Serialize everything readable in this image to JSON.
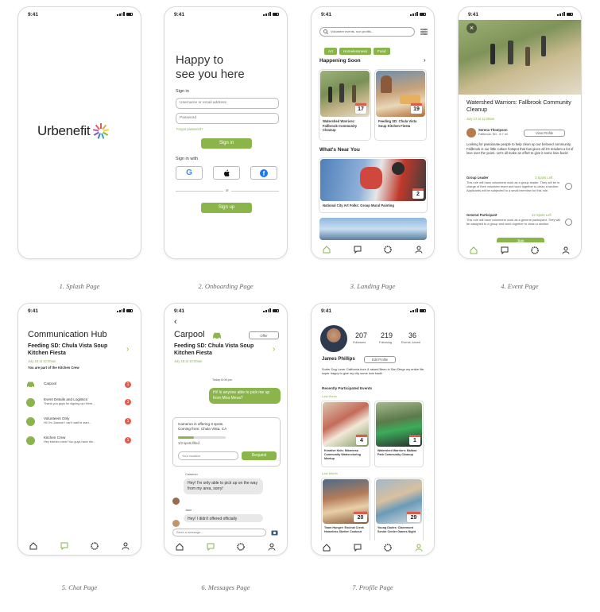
{
  "status": {
    "time": "9:41"
  },
  "captions": [
    "1. Splash Page",
    "2. Onboarding Page",
    "3. Landing Page",
    "4. Event Page",
    "5. Chat Page",
    "6. Messages Page",
    "7. Profile Page"
  ],
  "splash": {
    "logo_text": "Urbenefit"
  },
  "onboarding": {
    "headline_1": "Happy to",
    "headline_2": "see you here",
    "sign_in_label": "Sign in",
    "username_placeholder": "Username or email address",
    "password_placeholder": "Password",
    "forgot": "Forgot password?",
    "sign_in_button": "Sign in",
    "sign_in_with": "Sign in with",
    "or": "or",
    "sign_up_button": "Sign up"
  },
  "landing": {
    "search_placeholder": "Volunteer events, non profits...",
    "chips": [
      "Art",
      "Homelessness",
      "Food"
    ],
    "happening_soon": "Happening Soon",
    "events": [
      {
        "title": "Watershed Warriors: Fallbrook Community Cleanup",
        "day": "17"
      },
      {
        "title": "Feeding SD: Chula Vista Soup Kitchen Fiesta",
        "day": "19"
      }
    ],
    "whats_near": "What's Near You",
    "near_event": {
      "title": "National City Art Folks: Group Mural Painting",
      "day": "2"
    }
  },
  "event": {
    "title": "Watershed Warriors: Fallbrook Community Cleanup",
    "date": "July 17 at 11:00am",
    "host_name": "Serena Thompson",
    "host_loc": "Fallbrook, SD - 8.7 mi",
    "view_profile": "View Profile",
    "description": "Looking for passionate people to help clean up our beloved community. Fallbrook is our little culture hotspot that has given all it's resident a lot of love over the years. Let's all make an effort to give it some love back!",
    "roles": [
      {
        "name": "Group Leader",
        "spots": "3 Spots Left",
        "desc": "This role will have volunteers work as a group leader. They will be in charge of their volunteer team and work together to clean a section. Applicants will be subjected to a small interview for this role."
      },
      {
        "name": "General Participant",
        "spots": "22 Spots Left",
        "desc": "This role will have volunteers work as a general participant. They will be assigned to a group and work together to clean a section."
      }
    ],
    "join": "Join"
  },
  "chat": {
    "title": "Communication Hub",
    "event": "Feeding SD: Chula Vista Soup Kitchen Fiesta",
    "date": "July 18 at 10:00am",
    "crew_note": "You are part of the Kitchen Crew",
    "items": [
      {
        "name": "Carpool",
        "sub": "",
        "badge": "1"
      },
      {
        "name": "Event Details and Logistics",
        "sub": "Thank you guys for signing up! Here...",
        "badge": "3"
      },
      {
        "name": "Volunteers Only",
        "sub": "Hi! I'm Joanna! I can't wait to start...",
        "badge": "1"
      },
      {
        "name": "Kitchen Crew",
        "sub": "Hey kitchen crew! You guys have the...",
        "badge": "1"
      }
    ]
  },
  "messages": {
    "title": "Carpool",
    "offer": "Offer",
    "event": "Feeding SD: Chula Vista Soup Kitchen Fiesta",
    "date": "July 18 at 10:00am",
    "time_stamp": "Today 6:08 pm",
    "my_msg": "Hi! Is anyone able to pick me up from Mira Mesa?",
    "offer_line1": "Cameron is offering 3 spots.",
    "offer_line2": "Coming from: Chula Vista, CA",
    "spots": "1/3 spots filled",
    "loc_placeholder": "Your location",
    "request": "Request",
    "sender": "Cameron",
    "reply": "Hey! I'm only able to pick up on the way from my area, sorry!",
    "sender2": "Jane",
    "reply2": "Hey! I didn't offered officially",
    "input_placeholder": "Send a message..."
  },
  "profile": {
    "followers": "207",
    "followers_label": "Followers",
    "following": "219",
    "following_label": "Following",
    "events": "36",
    "events_label": "Events Joined",
    "name": "James Phillips",
    "edit": "Edit Profile",
    "bio": "Surfer Dog Lover California born & raised Been in San Diego my entire life, super happy to give my city some love back!",
    "recent": "Recently Participated Events",
    "last_week": "Last Week",
    "last_month": "Last Month",
    "items": [
      {
        "title": "Kreative Kids: Miramesa Community Watercoloring Meetup",
        "day": "4"
      },
      {
        "title": "Watershed Warriors: Balboa Park Community Cleanup",
        "day": "1"
      },
      {
        "title": "Team Hunger: Encinal Creek Homeless Shelter Cookout",
        "day": "20"
      },
      {
        "title": "Young Dudes: Clairemont Senior Center Games Night",
        "day": "29"
      }
    ]
  },
  "colors": {
    "accent": "#8ab54a",
    "badge": "#e25b4d"
  }
}
